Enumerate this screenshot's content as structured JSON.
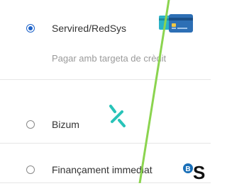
{
  "payment_options": [
    {
      "label": "Servired/RedSys",
      "description": "Pagar amb targeta de crèdit",
      "selected": true,
      "icon": "credit-card-icon"
    },
    {
      "label": "Bizum",
      "selected": false,
      "icon": "bizum-logo"
    },
    {
      "label": "Finançament immediat",
      "selected": false,
      "icon": "bs-logo",
      "icon_text": "S"
    }
  ],
  "colors": {
    "radio_selected": "#1e63c9",
    "text": "#333333",
    "muted_text": "#9a9a9a",
    "card_blue": "#2d6fb5",
    "card_teal": "#2bb3c7",
    "bizum_teal": "#28c3b8",
    "bs_blue": "#1a6fb8",
    "slash_green": "#8bd44f"
  }
}
